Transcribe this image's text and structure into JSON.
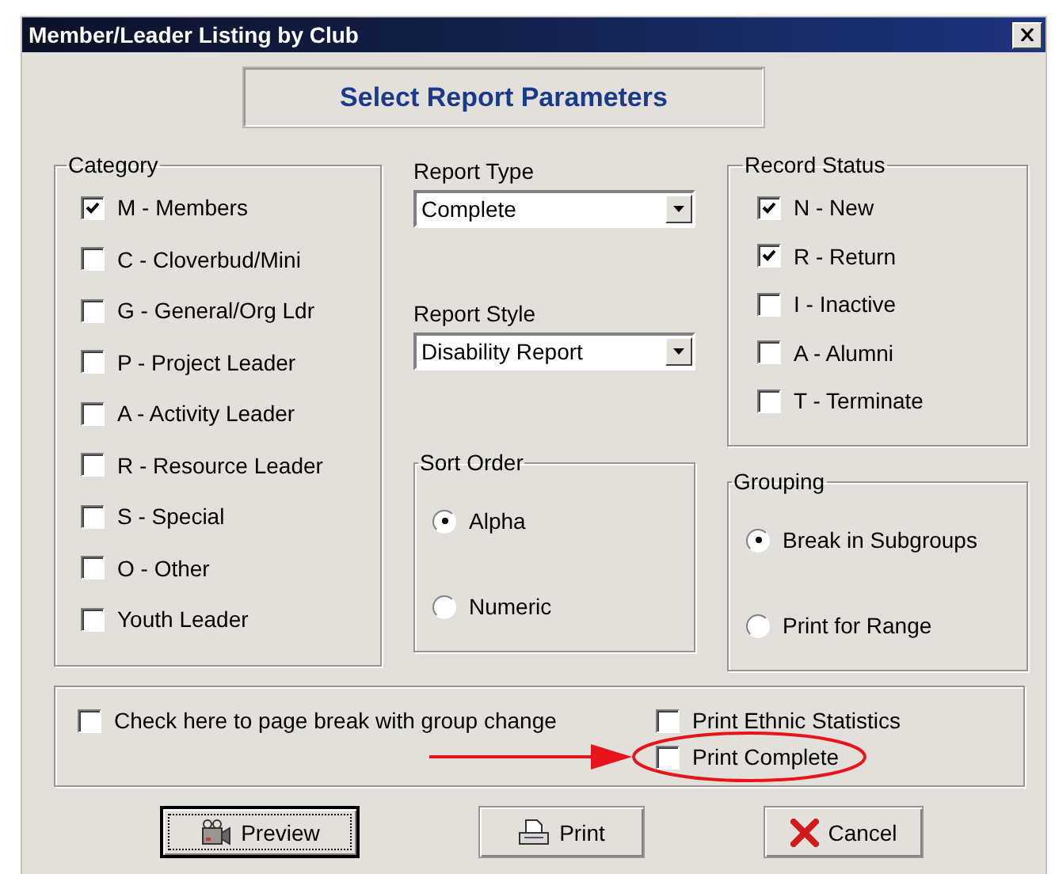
{
  "window": {
    "title": "Member/Leader Listing by Club"
  },
  "header": "Select Report Parameters",
  "category": {
    "label": "Category",
    "items": [
      {
        "label": "M - Members",
        "checked": true
      },
      {
        "label": "C - Cloverbud/Mini",
        "checked": false
      },
      {
        "label": "G - General/Org Ldr",
        "checked": false
      },
      {
        "label": "P - Project Leader",
        "checked": false
      },
      {
        "label": "A - Activity Leader",
        "checked": false
      },
      {
        "label": "R - Resource Leader",
        "checked": false
      },
      {
        "label": "S - Special",
        "checked": false
      },
      {
        "label": "O - Other",
        "checked": false
      },
      {
        "label": "Youth Leader",
        "checked": false
      }
    ]
  },
  "report_type": {
    "label": "Report Type",
    "value": "Complete"
  },
  "report_style": {
    "label": "Report Style",
    "value": "Disability Report"
  },
  "sort_order": {
    "label": "Sort Order",
    "options": [
      {
        "label": "Alpha",
        "selected": true
      },
      {
        "label": "Numeric",
        "selected": false
      }
    ]
  },
  "record_status": {
    "label": "Record Status",
    "items": [
      {
        "label": "N - New",
        "checked": true
      },
      {
        "label": "R - Return",
        "checked": true
      },
      {
        "label": "I - Inactive",
        "checked": false
      },
      {
        "label": "A - Alumni",
        "checked": false
      },
      {
        "label": "T - Terminate",
        "checked": false
      }
    ]
  },
  "grouping": {
    "label": "Grouping",
    "options": [
      {
        "label": "Break in Subgroups",
        "selected": true
      },
      {
        "label": "Print for Range",
        "selected": false
      }
    ]
  },
  "options": [
    {
      "label": "Check here to page break with group change",
      "checked": false,
      "highlighted": false
    },
    {
      "label": "Print Ethnic Statistics",
      "checked": false,
      "highlighted": false
    },
    {
      "label": "Print Complete",
      "checked": false,
      "highlighted": true
    }
  ],
  "buttons": [
    {
      "label": "Preview",
      "kind": "preview",
      "default": true
    },
    {
      "label": "Print",
      "kind": "print",
      "default": false
    },
    {
      "label": "Cancel",
      "kind": "cancel",
      "default": false
    }
  ]
}
